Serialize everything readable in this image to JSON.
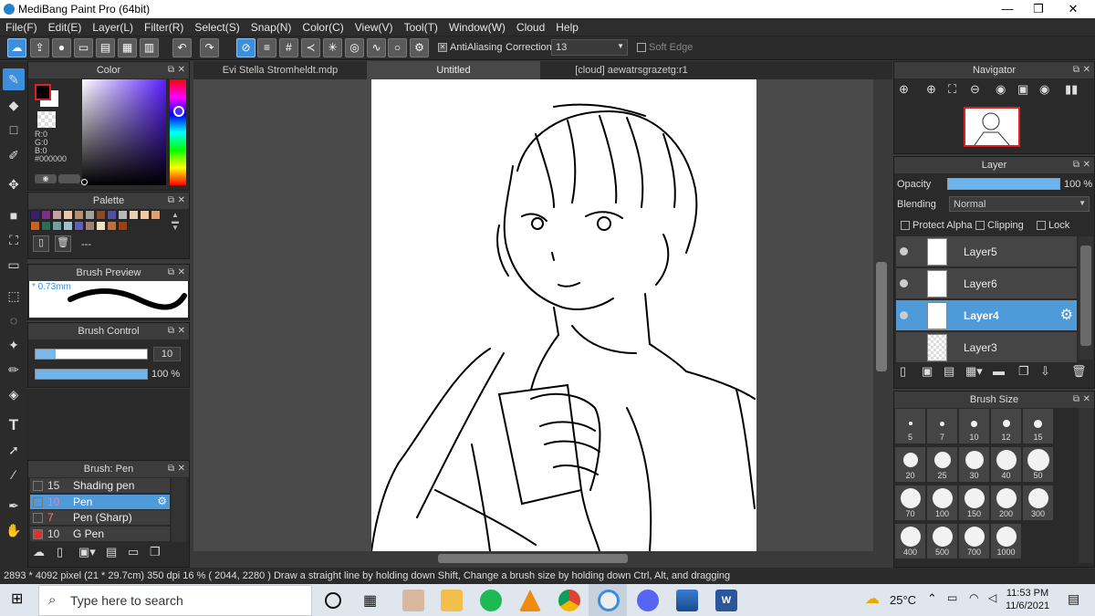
{
  "window": {
    "title": "MediBang Paint Pro (64bit)",
    "min": "—",
    "max": "❐",
    "close": "✕"
  },
  "menu": [
    "File(F)",
    "Edit(E)",
    "Layer(L)",
    "Filter(R)",
    "Select(S)",
    "Snap(N)",
    "Color(C)",
    "View(V)",
    "Tool(T)",
    "Window(W)",
    "Cloud",
    "Help"
  ],
  "toolbar": {
    "antialias_label": "AntiAliasing",
    "correction_label": "Correction",
    "correction_value": "13",
    "soft_edge_label": "Soft Edge"
  },
  "color_panel": {
    "title": "Color",
    "r": "R:0",
    "g": "G:0",
    "b": "B:0",
    "hex": "#000000",
    "primary": "#000000",
    "secondary": "#ffffff"
  },
  "palette": {
    "title": "Palette",
    "colors": [
      "#3a1f6b",
      "#7a2f86",
      "#c8a0a0",
      "#e8c8a8",
      "#b49070",
      "#a0a0a0",
      "#8a4a2a",
      "#5050a0",
      "#b8b8b8",
      "#e8d0b0",
      "#f0c8a0",
      "#e0a070",
      "#d06020",
      "#2a7050",
      "#70a0a0",
      "#a0c0d0",
      "#6060b0",
      "#a08070",
      "#f0e0c0",
      "#c07040",
      "#a04010"
    ],
    "empty_label": "---"
  },
  "brush_preview": {
    "title": "Brush Preview",
    "size_label": "* 0.73mm"
  },
  "brush_control": {
    "title": "Brush Control",
    "size_value": "10",
    "opacity_value": "100 %",
    "size_fraction": 0.18,
    "opacity_fraction": 1.0
  },
  "brush_list": {
    "title": "Brush: Pen",
    "items": [
      {
        "size": "15",
        "name": "Shading pen",
        "color": "#333333"
      },
      {
        "size": "10",
        "name": "Pen",
        "color": "#333333"
      },
      {
        "size": "7",
        "name": "Pen (Sharp)",
        "color": "#333333"
      },
      {
        "size": "10",
        "name": "G Pen",
        "color": "#e03030"
      }
    ]
  },
  "tabs": [
    "Evi Stella Stromheldt.mdp",
    "Untitled",
    "[cloud] aewatrsgrazetg:r1"
  ],
  "navigator": {
    "title": "Navigator"
  },
  "layer_panel": {
    "title": "Layer",
    "opacity_label": "Opacity",
    "opacity_value": "100 %",
    "blending_label": "Blending",
    "blending_value": "Normal",
    "protect_alpha": "Protect Alpha",
    "clipping": "Clipping",
    "lock": "Lock",
    "layers": [
      "Layer5",
      "Layer6",
      "Layer4",
      "Layer3"
    ]
  },
  "brush_size": {
    "title": "Brush Size",
    "sizes": [
      "5",
      "7",
      "10",
      "12",
      "15",
      "20",
      "25",
      "30",
      "40",
      "50",
      "70",
      "100",
      "150",
      "200",
      "300",
      "400",
      "500",
      "700",
      "1000"
    ]
  },
  "status": {
    "text": "2893 * 4092 pixel  (21 * 29.7cm)  350 dpi  16 %  ( 2044, 2280 )  Draw a straight line by holding down Shift, Change a brush size by holding down Ctrl, Alt, and dragging"
  },
  "taskbar": {
    "search_placeholder": "Type here to search",
    "weather": "25°C",
    "time": "11:53 PM",
    "date": "11/6/2021"
  }
}
